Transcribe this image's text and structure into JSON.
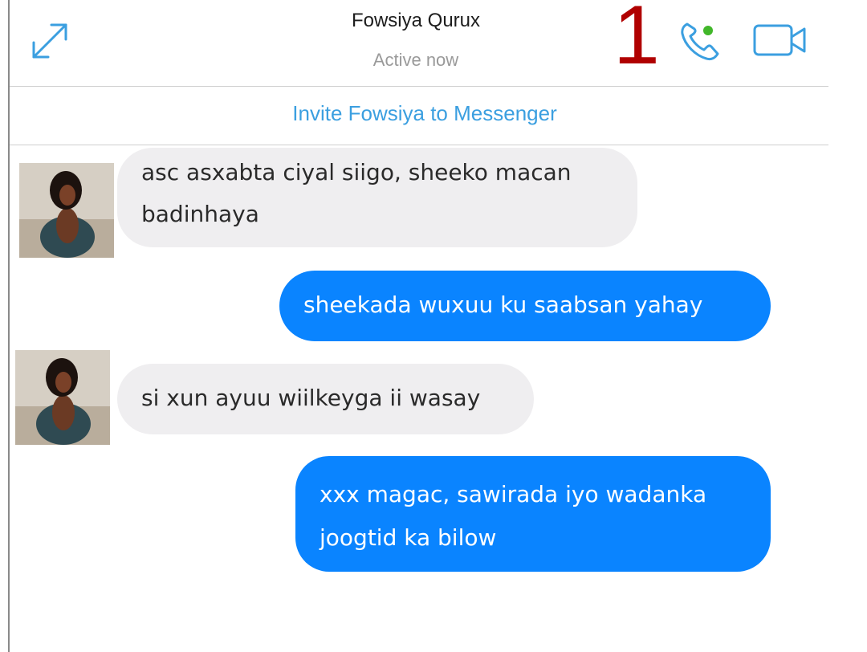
{
  "header": {
    "contact_name": "Fowsiya Qurux",
    "status": "Active now",
    "annotation_number": "1",
    "icons": [
      "expand-icon",
      "phone-call-icon",
      "video-camera-icon"
    ],
    "online_dot_color": "#42b72a",
    "icon_color": "#3b9fe0"
  },
  "invite": {
    "label": "Invite Fowsiya to Messenger"
  },
  "messages": [
    {
      "direction": "incoming",
      "text": "asc asxabta ciyal siigo, sheeko macan badinhaya"
    },
    {
      "direction": "outgoing",
      "text": "sheekada  wuxuu ku saabsan yahay"
    },
    {
      "direction": "incoming",
      "text": "si xun ayuu wiilkeyga ii wasay"
    },
    {
      "direction": "outgoing",
      "text": "xxx magac, sawirada iyo wadanka joogtid ka bilow"
    }
  ],
  "colors": {
    "outgoing_bubble": "#0a84ff",
    "incoming_bubble": "#efeef0",
    "annotation": "#b00000"
  }
}
